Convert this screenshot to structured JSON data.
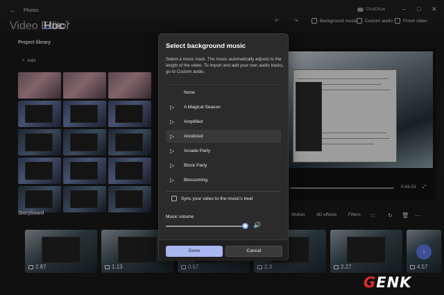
{
  "app": {
    "name": "Photos",
    "onedrive": "OneDrive"
  },
  "breadcrumbs": [
    {
      "label": "Video Editor"
    },
    {
      "label": "Hoc"
    }
  ],
  "toolbar": {
    "background_music": "Background music",
    "custom_audio": "Custom audio",
    "finish_video": "Finish video"
  },
  "library": {
    "title": "Project library",
    "add_label": "Add"
  },
  "preview": {
    "time": "0:43.53"
  },
  "storyboard": {
    "title": "Storyboard",
    "tools": {
      "motion": "Motion",
      "effects_3d": "3D effects",
      "filters": "Filters"
    },
    "clips": [
      {
        "duration": "2.87"
      },
      {
        "duration": "1.13"
      },
      {
        "duration": "0.57"
      },
      {
        "duration": "2.3"
      },
      {
        "duration": "2.27"
      },
      {
        "duration": "4.57"
      }
    ]
  },
  "dialog": {
    "title": "Select background music",
    "description": "Select a music track. The music automatically adjusts to the length of the video. To import and add your own audio tracks, go to Custom audio.",
    "tracks": [
      {
        "label": "None"
      },
      {
        "label": "A Magical Season"
      },
      {
        "label": "Amplified"
      },
      {
        "label": "Anodized"
      },
      {
        "label": "Arcade Party"
      },
      {
        "label": "Block Party"
      },
      {
        "label": "Blossoming"
      }
    ],
    "selected_track": "Anodized",
    "sync_label": "Sync your video to the music's beat",
    "sync_checked": false,
    "volume_label": "Music volume",
    "volume_level": 0.95,
    "done": "Done",
    "cancel": "Cancel"
  },
  "watermark": {
    "logo_text": "GENK"
  },
  "colors": {
    "accent": "#a9b7f0",
    "next_button": "#5e7ae6",
    "logo_red": "#e22b2b"
  }
}
